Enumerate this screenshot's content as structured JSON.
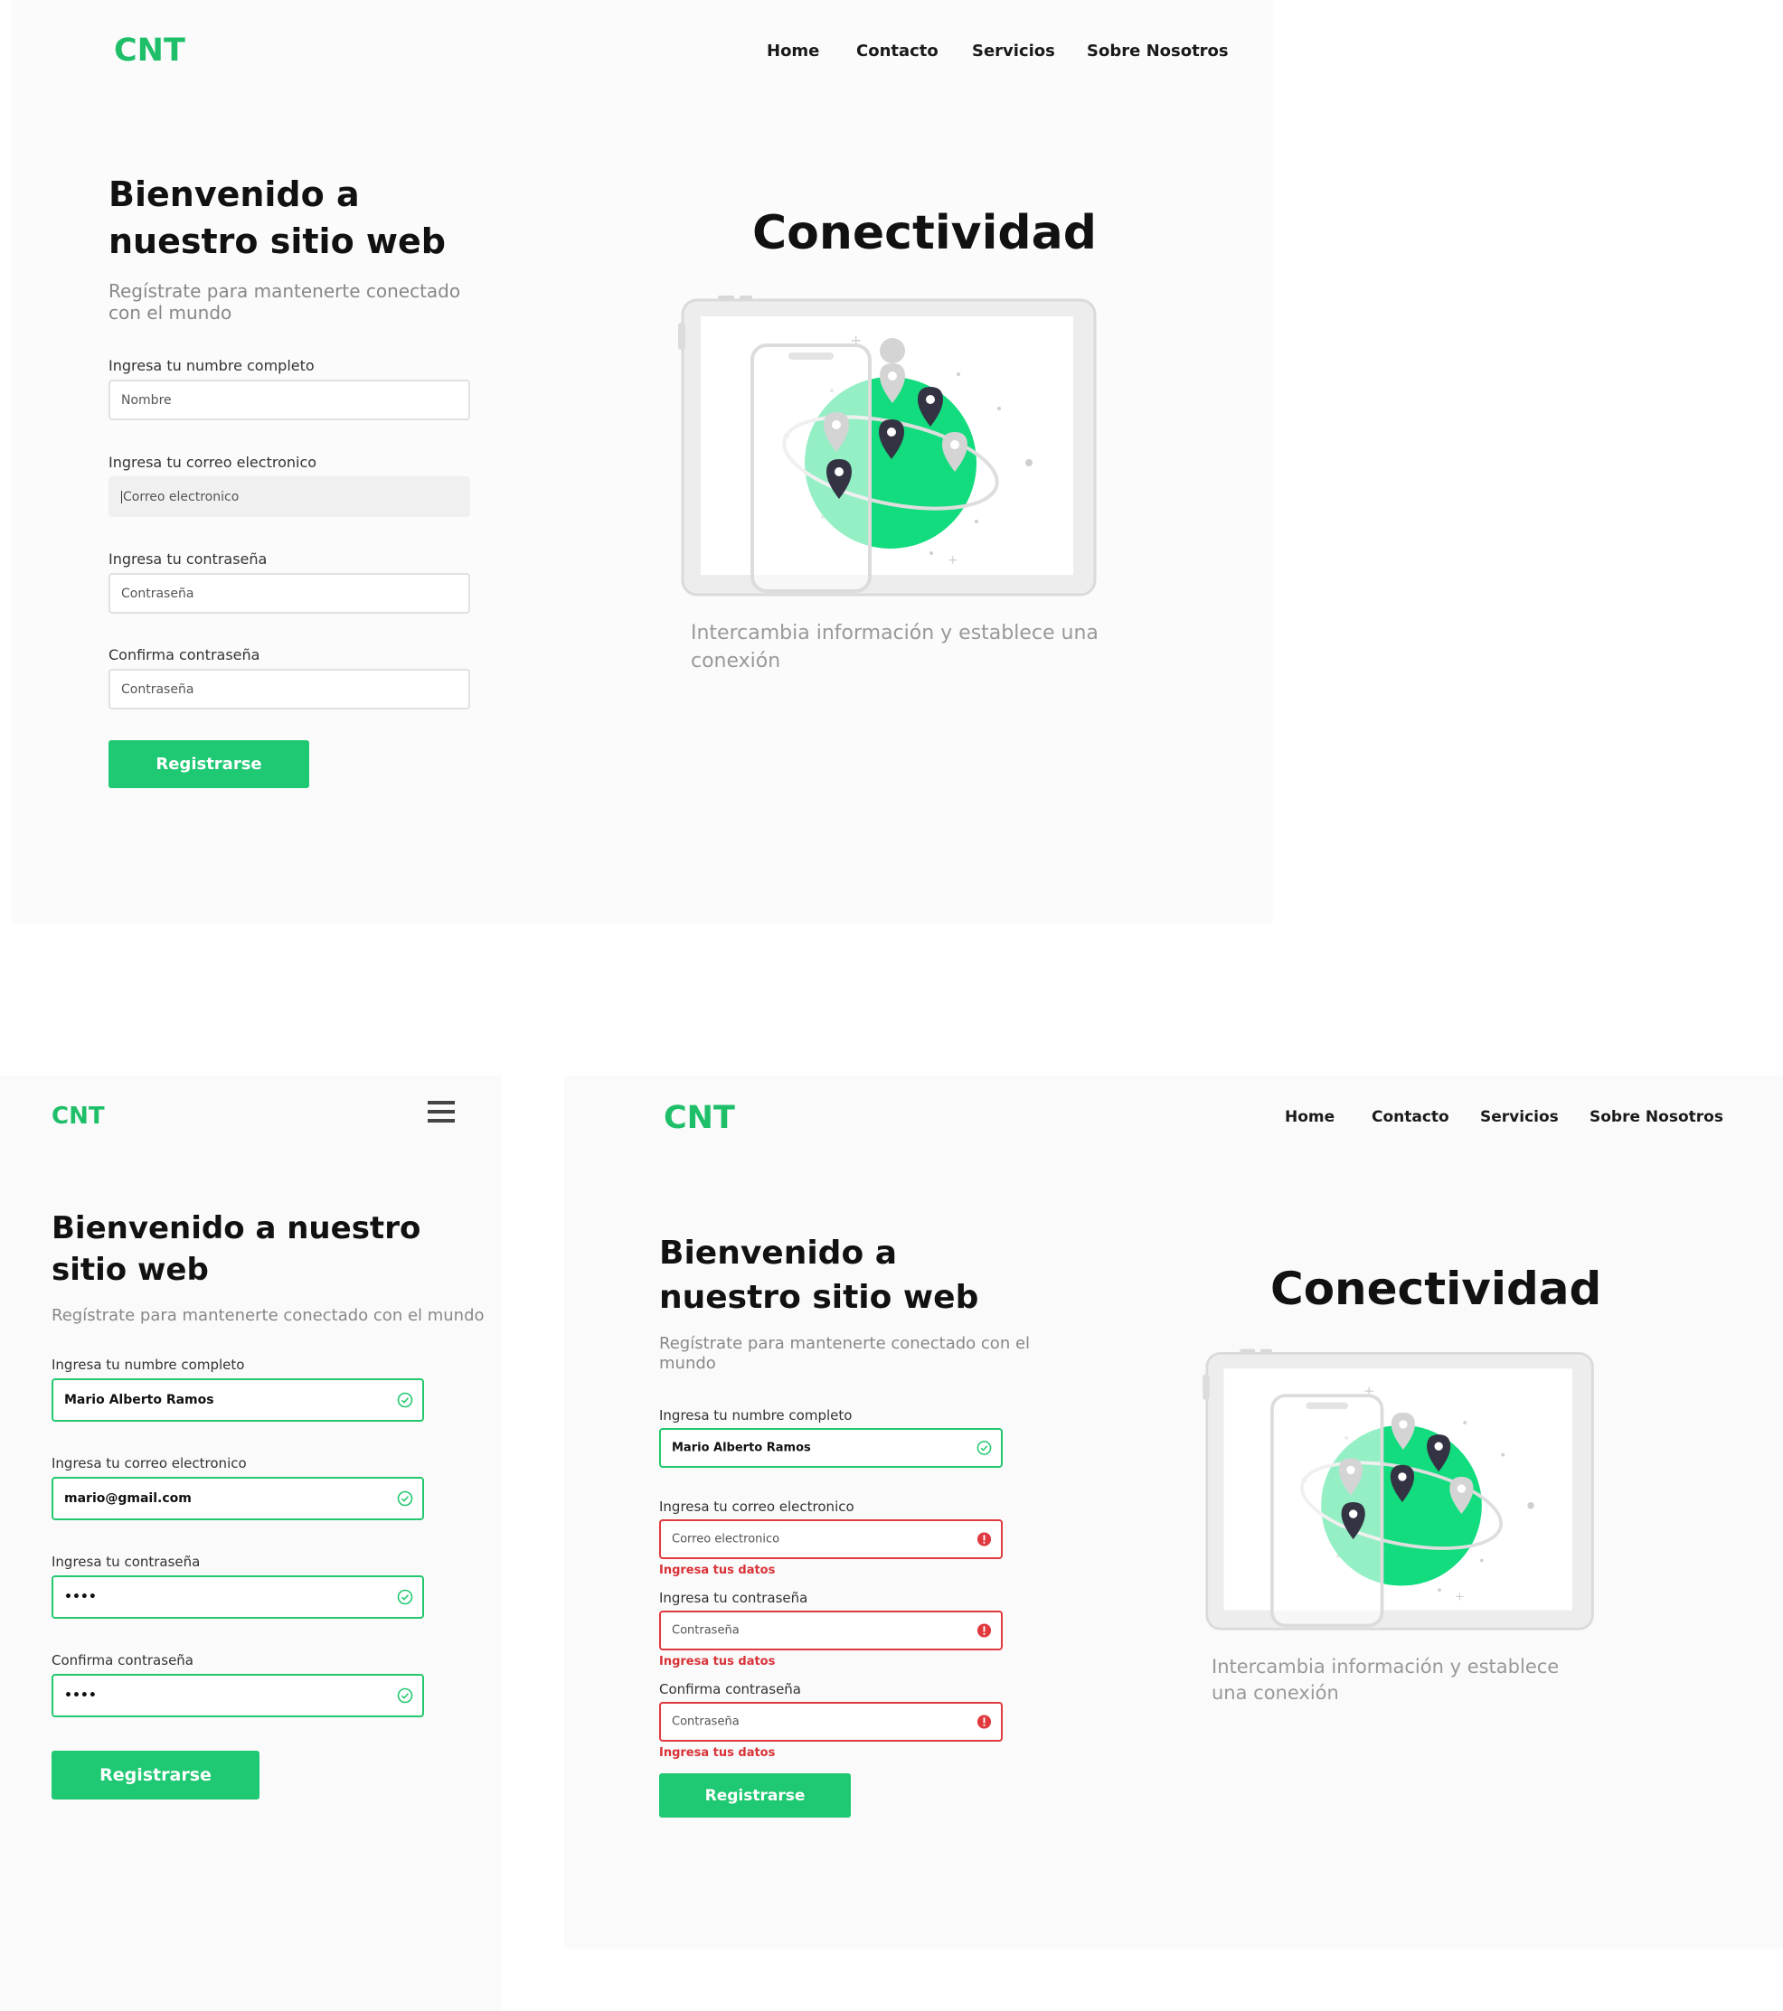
{
  "brand": {
    "logo": "CNT",
    "accent": "#1fc872",
    "error": "#e0393e"
  },
  "nav": {
    "home": "Home",
    "contacto": "Contacto",
    "servicios": "Servicios",
    "sobre": "Sobre Nosotros"
  },
  "form": {
    "title": "Bienvenido a nuestro sitio web",
    "subtitle": "Regístrate para mantenerte conectado con el mundo",
    "name_label": "Ingresa tu numbre completo",
    "name_placeholder": "Nombre",
    "email_label": "Ingresa tu correo electronico",
    "email_placeholder": "Correo electronico",
    "password_label": "Ingresa tu contraseña",
    "password_placeholder": "Contraseña",
    "confirm_label": "Confirma contraseña",
    "confirm_placeholder": "Contraseña",
    "submit": "Registrarse",
    "error_text": "Ingresa tus datos"
  },
  "filled": {
    "name": "Mario Alberto Ramos",
    "email": "mario@gmail.com",
    "password": "••••",
    "confirm": "••••"
  },
  "hero": {
    "title": "Conectividad",
    "description": "Intercambia información y establece una conexión"
  },
  "icons": [
    "menu-icon",
    "check-circle-icon",
    "error-circle-icon",
    "map-pin-icon",
    "tablet-illustration",
    "globe-illustration"
  ]
}
